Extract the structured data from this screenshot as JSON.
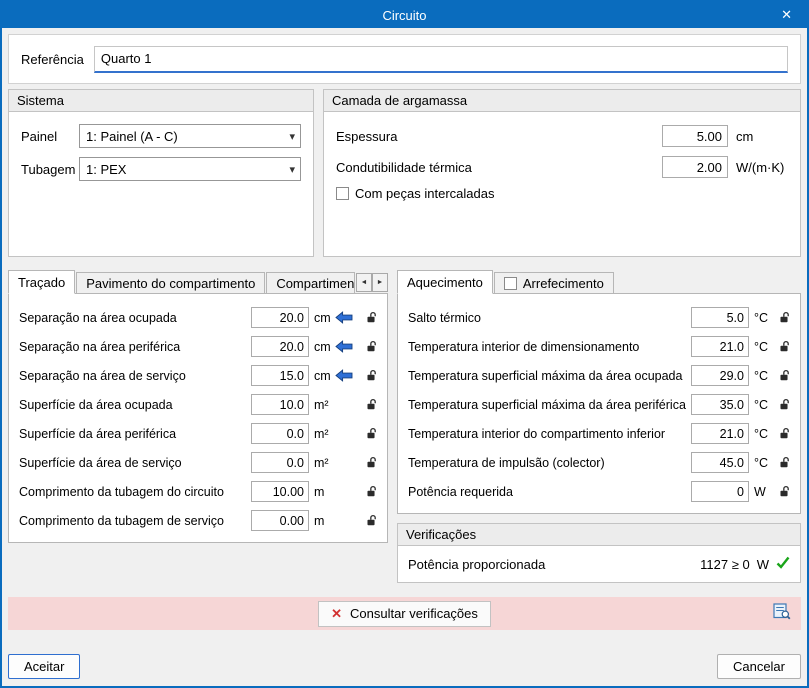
{
  "window": {
    "title": "Circuito"
  },
  "icons": {
    "close": "✕",
    "chevron_down": "▾",
    "scroll_left": "◄",
    "scroll_right": "►",
    "red_x": "✕"
  },
  "reference": {
    "label": "Referência",
    "value": "Quarto 1"
  },
  "sistema": {
    "title": "Sistema",
    "painel_label": "Painel",
    "painel_value": "1: Painel (A - C)",
    "tubagem_label": "Tubagem",
    "tubagem_value": "1: PEX"
  },
  "argamassa": {
    "title": "Camada de argamassa",
    "espessura_label": "Espessura",
    "espessura_value": "5.00",
    "espessura_unit": "cm",
    "condutibilidade_label": "Condutibilidade térmica",
    "condutibilidade_value": "2.00",
    "condutibilidade_unit": "W/(m·K)",
    "checkbox_label": "Com peças intercaladas"
  },
  "left_tabs": {
    "tabs": [
      "Traçado",
      "Pavimento do compartimento",
      "Compartimento inferior"
    ],
    "rows": [
      {
        "label": "Separação na área ocupada",
        "value": "20.0",
        "unit": "cm"
      },
      {
        "label": "Separação na área periférica",
        "value": "20.0",
        "unit": "cm"
      },
      {
        "label": "Separação na área de serviço",
        "value": "15.0",
        "unit": "cm"
      },
      {
        "label": "Superfície da área ocupada",
        "value": "10.0",
        "unit": "m²"
      },
      {
        "label": "Superfície da área periférica",
        "value": "0.0",
        "unit": "m²"
      },
      {
        "label": "Superfície da área de serviço",
        "value": "0.0",
        "unit": "m²"
      },
      {
        "label": "Comprimento da tubagem do circuito",
        "value": "10.00",
        "unit": "m"
      },
      {
        "label": "Comprimento da tubagem de serviço",
        "value": "0.00",
        "unit": "m"
      }
    ]
  },
  "right_tabs": {
    "tabs": [
      "Aquecimento",
      "Arrefecimento"
    ],
    "rows": [
      {
        "label": "Salto térmico",
        "value": "5.0",
        "unit": "°C"
      },
      {
        "label": "Temperatura interior de dimensionamento",
        "value": "21.0",
        "unit": "°C"
      },
      {
        "label": "Temperatura superficial máxima da área ocupada",
        "value": "29.0",
        "unit": "°C"
      },
      {
        "label": "Temperatura superficial máxima da área periférica",
        "value": "35.0",
        "unit": "°C"
      },
      {
        "label": "Temperatura interior do compartimento inferior",
        "value": "21.0",
        "unit": "°C"
      },
      {
        "label": "Temperatura de impulsão (colector)",
        "value": "45.0",
        "unit": "°C"
      },
      {
        "label": "Potência requerida",
        "value": "0",
        "unit": "W"
      }
    ]
  },
  "verificacoes": {
    "title": "Verificações",
    "label": "Potência proporcionada",
    "value": "1127 ≥ 0",
    "unit": "W"
  },
  "actions": {
    "consultar": "Consultar verificações"
  },
  "footer": {
    "accept": "Aceitar",
    "cancel": "Cancelar"
  }
}
